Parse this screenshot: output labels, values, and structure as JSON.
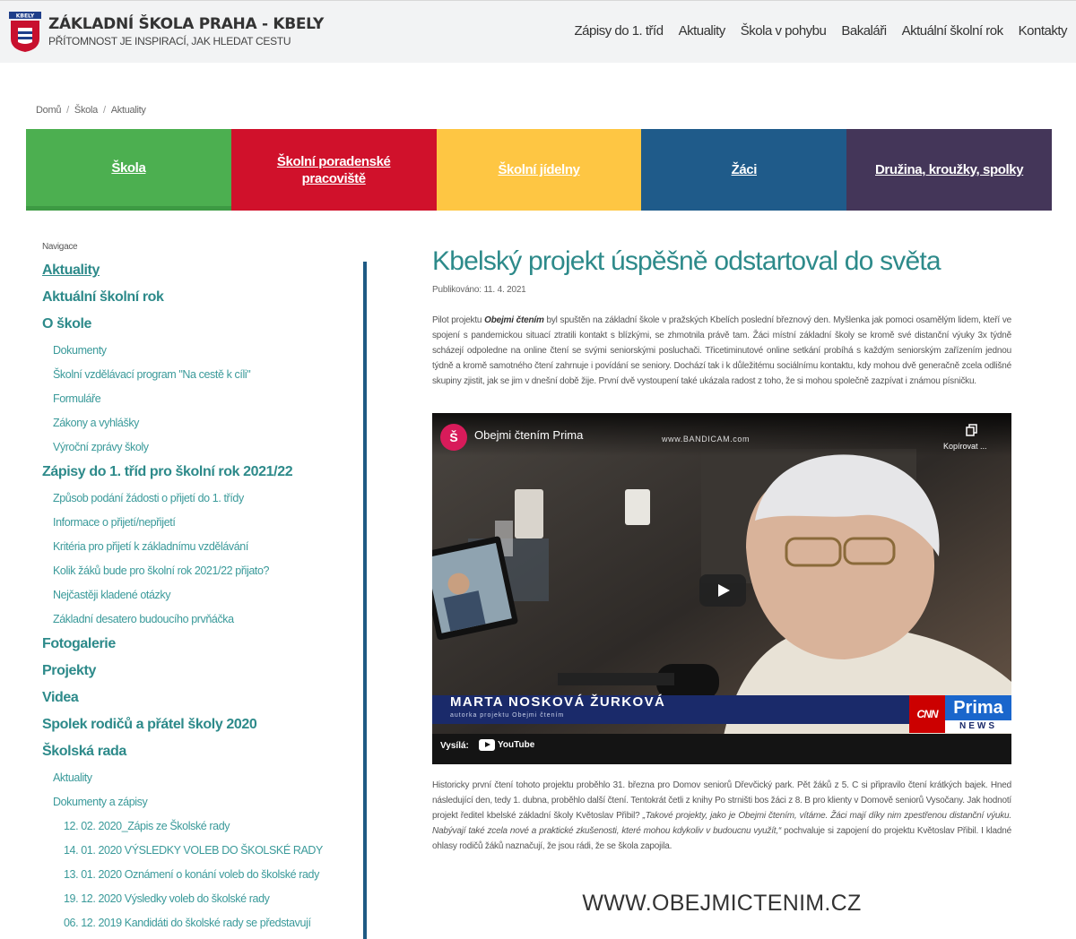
{
  "header": {
    "school_name": "ZÁKLADNÍ ŠKOLA PRAHA - KBELY",
    "tagline": "PŘÍTOMNOST JE INSPIRACÍ, JAK HLEDAT CESTU",
    "logo_text": "KBELY",
    "nav": [
      "Zápisy do 1. tříd",
      "Aktuality",
      "Škola v pohybu",
      "Bakaláři",
      "Aktuální školní rok",
      "Kontakty"
    ]
  },
  "breadcrumb": [
    "Domů",
    "Škola",
    "Aktuality"
  ],
  "tiles": [
    {
      "label": "Škola",
      "color": "#4caf50"
    },
    {
      "label": "Školní poradenské pracoviště",
      "color": "#d0112b"
    },
    {
      "label": "Školní jídelny",
      "color": "#fec643"
    },
    {
      "label": "Žáci",
      "color": "#1f5b8a"
    },
    {
      "label": "Družina, kroužky, spolky",
      "color": "#443659"
    }
  ],
  "sidebar": {
    "label": "Navigace",
    "items": [
      {
        "label": "Aktuality",
        "level": 1,
        "active": true
      },
      {
        "label": "Aktuální školní rok",
        "level": 1
      },
      {
        "label": "O škole",
        "level": 1
      },
      {
        "label": "Dokumenty",
        "level": 2
      },
      {
        "label": "Školní vzdělávací program \"Na cestě k cíli\"",
        "level": 2
      },
      {
        "label": "Formuláře",
        "level": 2
      },
      {
        "label": "Zákony a vyhlášky",
        "level": 2
      },
      {
        "label": "Výroční zprávy školy",
        "level": 2
      },
      {
        "label": "Zápisy do 1. tříd pro školní rok 2021/22",
        "level": 1
      },
      {
        "label": "Způsob podání žádosti o přijetí do 1. třídy",
        "level": 2
      },
      {
        "label": "Informace o přijetí/nepřijetí",
        "level": 2
      },
      {
        "label": "Kritéria pro přijetí k základnímu vzdělávání",
        "level": 2
      },
      {
        "label": "Kolik žáků bude pro školní rok 2021/22 přijato?",
        "level": 2
      },
      {
        "label": "Nejčastěji kladené otázky",
        "level": 2
      },
      {
        "label": "Základní desatero budoucího prvňáčka",
        "level": 2
      },
      {
        "label": "Fotogalerie",
        "level": 1
      },
      {
        "label": "Projekty",
        "level": 1
      },
      {
        "label": "Videa",
        "level": 1
      },
      {
        "label": "Spolek rodičů a přátel školy 2020",
        "level": 1
      },
      {
        "label": "Školská rada",
        "level": 1
      },
      {
        "label": "Aktuality",
        "level": 2
      },
      {
        "label": "Dokumenty a zápisy",
        "level": 2
      },
      {
        "label": "12. 02. 2020_Zápis ze Školské rady",
        "level": 3
      },
      {
        "label": "14. 01. 2020 VÝSLEDKY VOLEB DO ŠKOLSKÉ RADY",
        "level": 3
      },
      {
        "label": "13. 01. 2020 Oznámení o konání voleb do školské rady",
        "level": 3
      },
      {
        "label": "19. 12. 2020 Výsledky voleb do školské rady",
        "level": 3
      },
      {
        "label": "06. 12. 2019 Kandidáti do školské rady se představují",
        "level": 3
      }
    ]
  },
  "article": {
    "title": "Kbelský projekt úspěšně odstartoval do světa",
    "published": "Publikováno: 11. 4. 2021",
    "p1_pre": "Pilot projektu ",
    "p1_bold": "Obejmi čtením",
    "p1_post": " byl spuštěn na základní škole v pražských Kbelích poslední březnový den. Myšlenka jak pomoci osamělým lidem, kteří ve spojení s pandemickou situací ztratili kontakt s blízkými, se zhmotnila právě tam. Žáci místní základní školy se kromě své distanční výuky 3x týdně scházejí odpoledne na online čtení se svými seniorskými posluchači. Třicetiminutové online setkání probíhá s každým seniorským zařízením jednou týdně a kromě samotného čtení zahrnuje i povídání se seniory. Dochází tak i k důležitému sociálnímu kontaktu, kdy mohou dvě generačně zcela odlišné skupiny zjistit, jak se jim v dnešní době žije. První dvě vystoupení také ukázala radost z toho, že si mohou společně zazpívat i známou písničku.",
    "p2_pre": "Historicky první čtení tohoto projektu proběhlo 31. března pro Domov seniorů Dřevčický park. Pět žáků z 5. C si připravilo čtení krátkých bajek. Hned následující den, tedy 1. dubna, proběhlo další čtení. Tentokrát četli z knihy Po strništi bos žáci z 8. B pro klienty v Domově seniorů Vysočany. Jak hodnotí projekt ředitel kbelské základní školy Květoslav Přibil? ",
    "p2_italic": "„Takové projekty, jako je Obejmi čtením, vítáme. Žáci mají díky nim zpestřenou distanční výuku. Nabývají také zcela nové a praktické zkušenosti, které mohou kdykoliv v budoucnu využít,“",
    "p2_post": " pochvaluje si zapojení do projektu Květoslav Přibil. I kladné ohlasy rodičů žáků naznačují, že jsou rádi, že se škola zapojila.",
    "url": "WWW.OBEJMICTENIM.CZ"
  },
  "video": {
    "channel_initial": "Š",
    "title": "Obejmi čtením Prima",
    "watermark": "www.BANDICAM.com",
    "copy_label": "Kopírovat ...",
    "name_caption": "MARTA NOSKOVÁ ŽURKOVÁ",
    "name_sub": "autorka projektu Obejmi čtením",
    "cnn": "CNN",
    "prima": "Prima",
    "news": "NEWS",
    "watch_on": "Vysílá:",
    "youtube": "YouTube"
  }
}
